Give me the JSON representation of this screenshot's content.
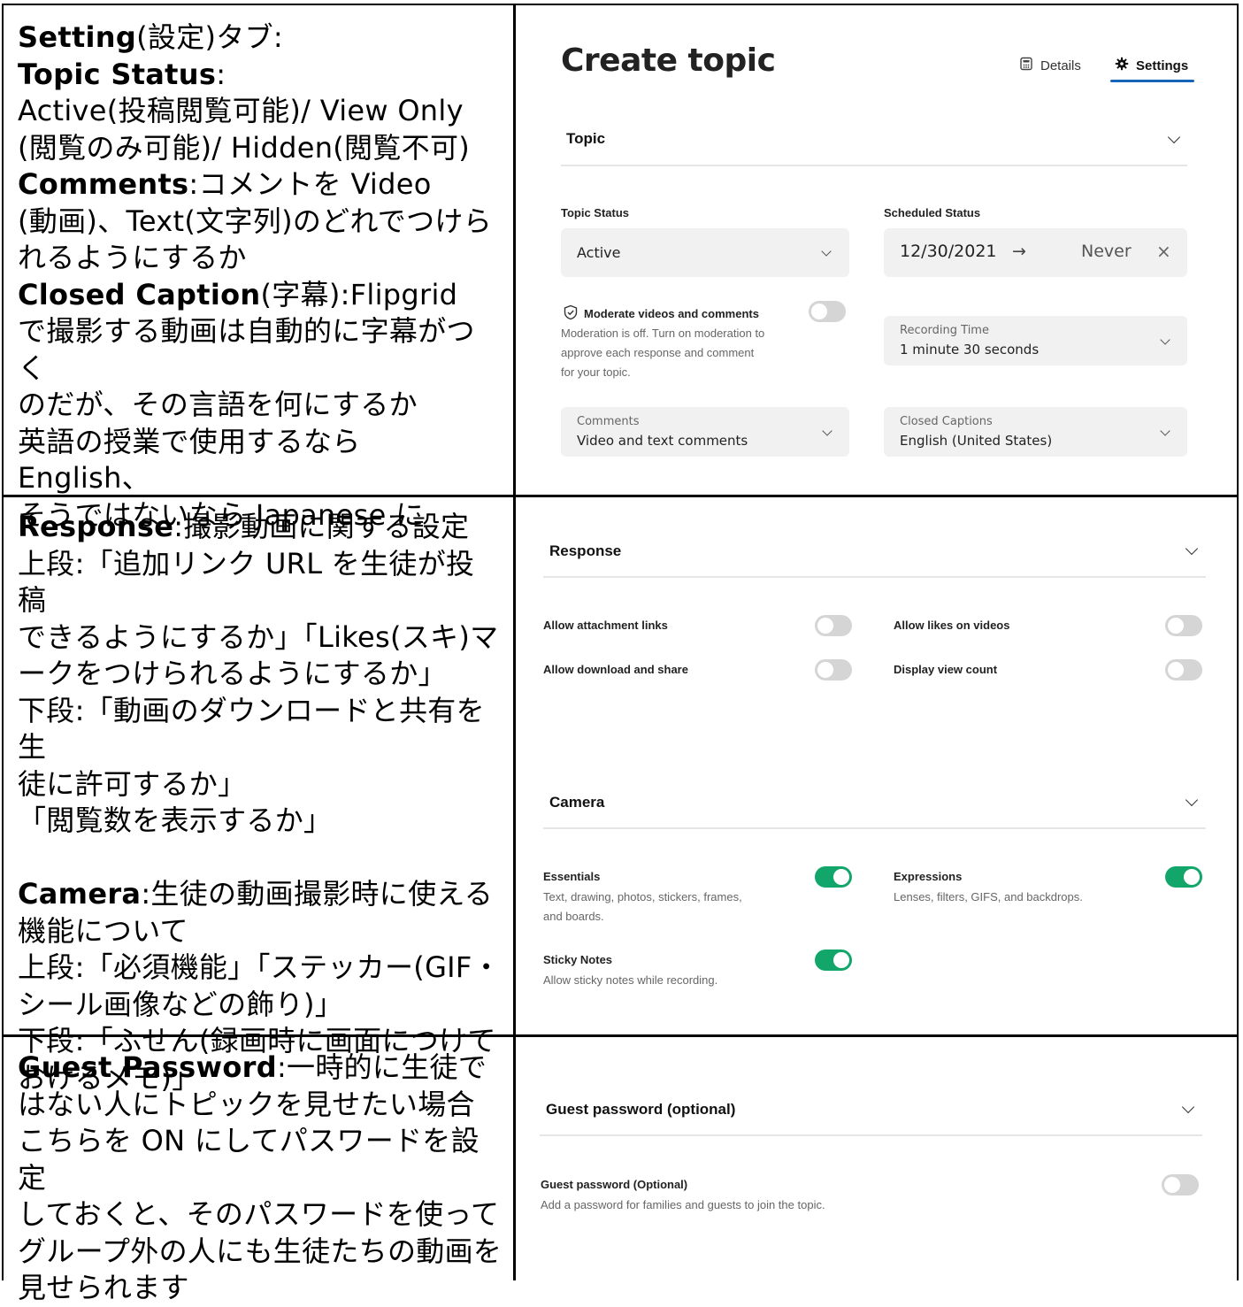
{
  "notes": {
    "row1": [
      {
        "b": "Setting",
        "t": "(設定)タブ:"
      },
      {
        "b": "Topic Status",
        "t": ":"
      },
      {
        "b": "",
        "t": "Active(投稿閲覧可能)/ View Only"
      },
      {
        "b": "",
        "t": "(閲覧のみ可能)/ Hidden(閲覧不可)"
      },
      {
        "b": "Comments",
        "t": ":コメントを Video"
      },
      {
        "b": "",
        "t": "(動画)、Text(文字列)のどれでつけら"
      },
      {
        "b": "",
        "t": "れるようにするか"
      },
      {
        "b": "Closed Caption",
        "t": "(字幕):Flipgrid"
      },
      {
        "b": "",
        "t": "で撮影する動画は自動的に字幕がつく"
      },
      {
        "b": "",
        "t": "のだが、その言語を何にするか"
      },
      {
        "b": "",
        "t": "英語の授業で使用するなら English、"
      },
      {
        "b": "",
        "t": "そうではないなら Japanese に"
      }
    ],
    "row2": [
      {
        "b": "Response",
        "t": ":撮影動画に関する設定"
      },
      {
        "b": "",
        "t": "上段:「追加リンク URL を生徒が投稿"
      },
      {
        "b": "",
        "t": "できるようにするか」「Likes(スキ)マ"
      },
      {
        "b": "",
        "t": "ークをつけられるようにするか」"
      },
      {
        "b": "",
        "t": "下段:「動画のダウンロードと共有を生"
      },
      {
        "b": "",
        "t": "徒に許可するか」"
      },
      {
        "b": "",
        "t": "「閲覧数を表示するか」"
      },
      {
        "b": "",
        "t": ""
      },
      {
        "b": "Camera",
        "t": ":生徒の動画撮影時に使える"
      },
      {
        "b": "",
        "t": "機能について"
      },
      {
        "b": "",
        "t": "上段:「必須機能」「ステッカー(GIF・"
      },
      {
        "b": "",
        "t": "シール画像などの飾り)」"
      },
      {
        "b": "",
        "t": "下段:「ふせん(録画時に画面につけて"
      },
      {
        "b": "",
        "t": "おけるメモ)」"
      }
    ],
    "row3": [
      {
        "b": "Guest Password",
        "t": ":一時的に生徒で"
      },
      {
        "b": "",
        "t": "はない人にトピックを見せたい場合"
      },
      {
        "b": "",
        "t": "こちらを ON にしてパスワードを設定"
      },
      {
        "b": "",
        "t": "しておくと、そのパスワードを使って"
      },
      {
        "b": "",
        "t": "グループ外の人にも生徒たちの動画を"
      },
      {
        "b": "",
        "t": "見せられます"
      }
    ]
  },
  "ui": {
    "title": "Create topic",
    "tabs": {
      "details": "Details",
      "settings": "Settings"
    },
    "topic": {
      "header": "Topic",
      "status_label": "Topic Status",
      "status_value": "Active",
      "scheduled_label": "Scheduled Status",
      "scheduled_start": "12/30/2021",
      "scheduled_arrow": "→",
      "scheduled_end": "Never",
      "moderate_label": "Moderate videos and comments",
      "moderate_desc_1": "Moderation is off. Turn on moderation to",
      "moderate_desc_2": "approve each response and comment",
      "moderate_desc_3": "for your topic.",
      "recording_caption": "Recording Time",
      "recording_value": "1 minute 30 seconds",
      "comments_caption": "Comments",
      "comments_value": "Video and text comments",
      "captions_caption": "Closed Captions",
      "captions_value": "English (United States)"
    },
    "response": {
      "header": "Response",
      "attachment": "Allow attachment links",
      "likes": "Allow likes on videos",
      "download": "Allow download and share",
      "viewcount": "Display view count"
    },
    "camera": {
      "header": "Camera",
      "essentials": "Essentials",
      "essentials_desc_1": "Text, drawing, photos, stickers, frames,",
      "essentials_desc_2": "and boards.",
      "expressions": "Expressions",
      "expressions_desc": "Lenses, filters, GIFS, and backdrops.",
      "sticky": "Sticky Notes",
      "sticky_desc": "Allow sticky notes while recording."
    },
    "guest": {
      "header": "Guest password (optional)",
      "label": "Guest password (Optional)",
      "desc": "Add a password for families and guests to join the topic."
    },
    "toggles": {
      "moderate": false,
      "attachment": false,
      "likes": false,
      "download": false,
      "viewcount": false,
      "essentials": true,
      "expressions": true,
      "sticky": true,
      "guest": false
    },
    "colors": {
      "accent": "#1765b8",
      "toggle_on": "#12a66b",
      "toggle_off": "#d5d5d5",
      "field_bg": "#f1f1f1"
    }
  }
}
